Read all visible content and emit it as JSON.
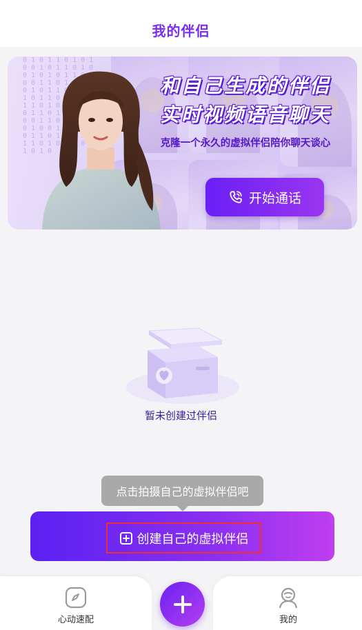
{
  "header": {
    "title": "我的伴侣"
  },
  "banner": {
    "headline_line1": "和自己生成的伴侣",
    "headline_line2": "实时视频语音聊天",
    "subline": "克隆一个永久的虚拟伴侣陪你聊天谈心",
    "call_button_label": "开始通话",
    "binary_digits": "0101101010010110100101011010011010100101101001011010101101010010110101010011010110100101010110100101101010011010",
    "colors": {
      "accent": "#7b2cf0",
      "headline_outline": "#5a1bd4",
      "subline": "#5518c9"
    }
  },
  "empty_state": {
    "text": "暂未创建过伴侣"
  },
  "tooltip": {
    "text": "点击拍摄自己的虚拟伴侣吧"
  },
  "create_button": {
    "label": "创建自己的虚拟伴侣",
    "icon": "plus-square-icon"
  },
  "tabbar": {
    "items": [
      {
        "label": "心动速配",
        "icon": "compass-icon"
      },
      {
        "label": "我的",
        "icon": "user-icon"
      }
    ],
    "center_action_icon": "plus-icon"
  }
}
